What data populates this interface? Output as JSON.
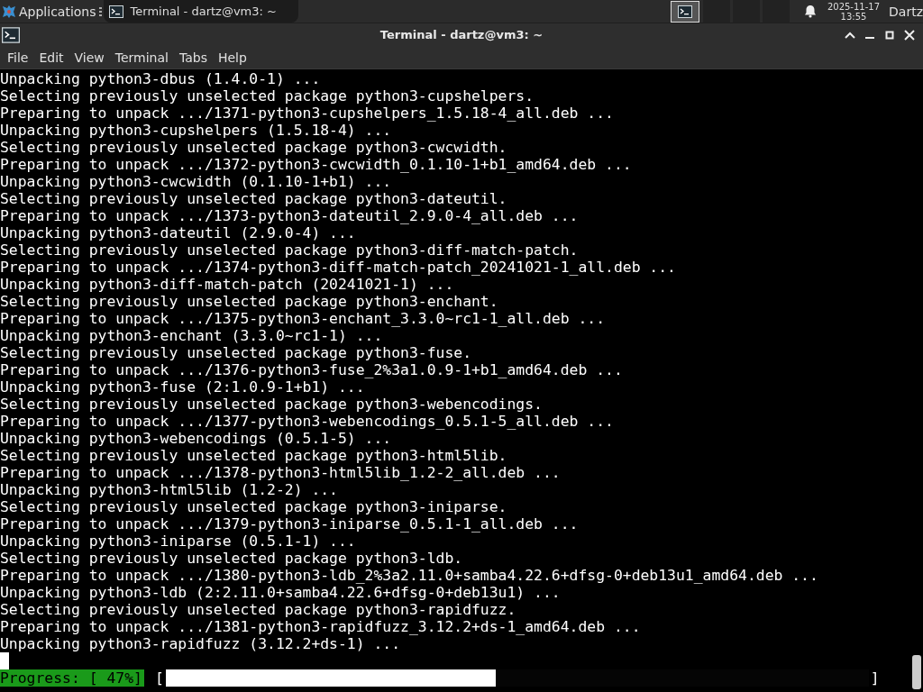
{
  "panel": {
    "applications": "Applications",
    "tasks": [
      {
        "label": "Terminal - dartz@vm3: ~",
        "selected": false
      }
    ],
    "clock_date": "2025-11-17",
    "clock_time": "13:55",
    "user": "Dartz"
  },
  "window": {
    "title": "Terminal - dartz@vm3: ~"
  },
  "menu": [
    "File",
    "Edit",
    "View",
    "Terminal",
    "Tabs",
    "Help"
  ],
  "terminal": {
    "lines": [
      "Unpacking python3-dbus (1.4.0-1) ...",
      "Selecting previously unselected package python3-cupshelpers.",
      "Preparing to unpack .../1371-python3-cupshelpers_1.5.18-4_all.deb ...",
      "Unpacking python3-cupshelpers (1.5.18-4) ...",
      "Selecting previously unselected package python3-cwcwidth.",
      "Preparing to unpack .../1372-python3-cwcwidth_0.1.10-1+b1_amd64.deb ...",
      "Unpacking python3-cwcwidth (0.1.10-1+b1) ...",
      "Selecting previously unselected package python3-dateutil.",
      "Preparing to unpack .../1373-python3-dateutil_2.9.0-4_all.deb ...",
      "Unpacking python3-dateutil (2.9.0-4) ...",
      "Selecting previously unselected package python3-diff-match-patch.",
      "Preparing to unpack .../1374-python3-diff-match-patch_20241021-1_all.deb ...",
      "Unpacking python3-diff-match-patch (20241021-1) ...",
      "Selecting previously unselected package python3-enchant.",
      "Preparing to unpack .../1375-python3-enchant_3.3.0~rc1-1_all.deb ...",
      "Unpacking python3-enchant (3.3.0~rc1-1) ...",
      "Selecting previously unselected package python3-fuse.",
      "Preparing to unpack .../1376-python3-fuse_2%3a1.0.9-1+b1_amd64.deb ...",
      "Unpacking python3-fuse (2:1.0.9-1+b1) ...",
      "Selecting previously unselected package python3-webencodings.",
      "Preparing to unpack .../1377-python3-webencodings_0.5.1-5_all.deb ...",
      "Unpacking python3-webencodings (0.5.1-5) ...",
      "Selecting previously unselected package python3-html5lib.",
      "Preparing to unpack .../1378-python3-html5lib_1.2-2_all.deb ...",
      "Unpacking python3-html5lib (1.2-2) ...",
      "Selecting previously unselected package python3-iniparse.",
      "Preparing to unpack .../1379-python3-iniparse_0.5.1-1_all.deb ...",
      "Unpacking python3-iniparse (0.5.1-1) ...",
      "Selecting previously unselected package python3-ldb.",
      "Preparing to unpack .../1380-python3-ldb_2%3a2.11.0+samba4.22.6+dfsg-0+deb13u1_amd64.deb ...",
      "Unpacking python3-ldb (2:2.11.0+samba4.22.6+dfsg-0+deb13u1) ...",
      "Selecting previously unselected package python3-rapidfuzz.",
      "Preparing to unpack .../1381-python3-rapidfuzz_3.12.2+ds-1_amd64.deb ...",
      "Unpacking python3-rapidfuzz (3.12.2+ds-1) ..."
    ],
    "progress": {
      "label": "Progress: [ 47%]",
      "open": "[",
      "close": "]",
      "level": 0.47
    }
  }
}
